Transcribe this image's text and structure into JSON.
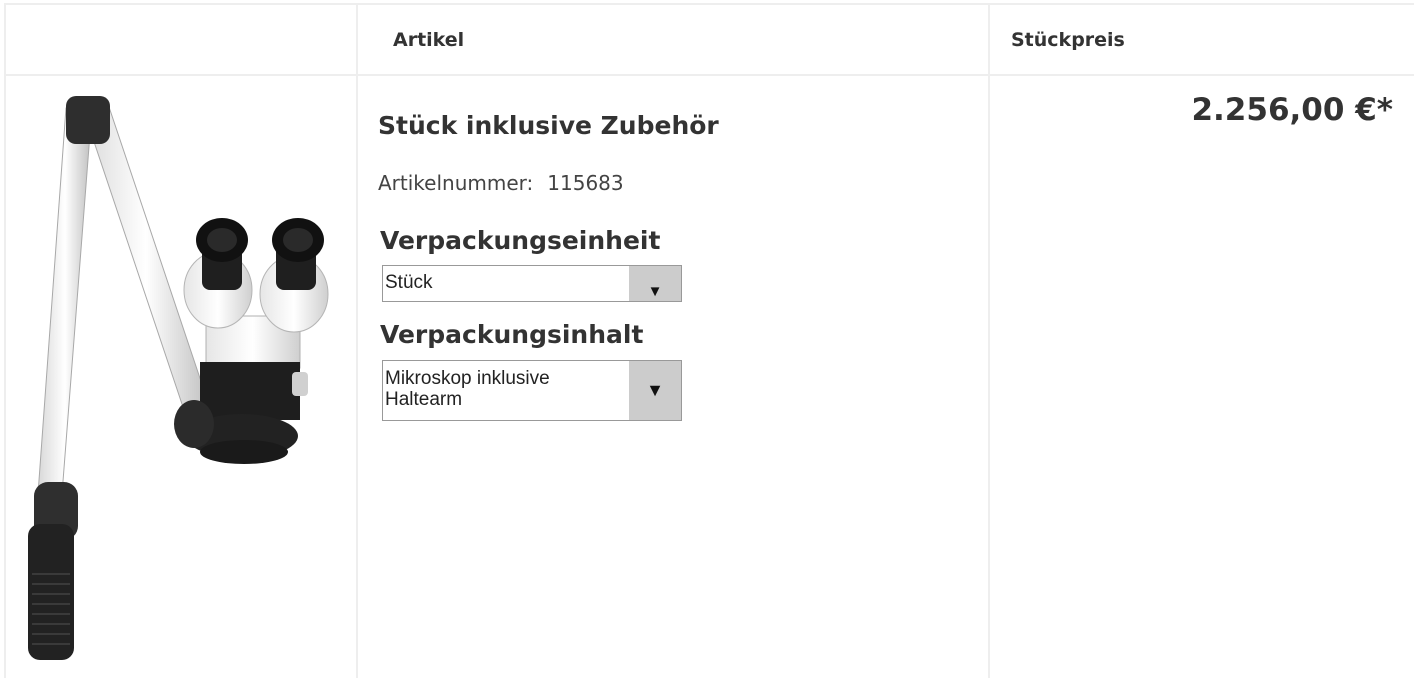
{
  "table": {
    "headers": {
      "article": "Artikel",
      "unit_price": "Stückpreis"
    }
  },
  "product": {
    "title": "Stück inklusive Zubehör",
    "article_number_label": "Artikelnummer:",
    "article_number": "115683",
    "image_icon": "microscope-image",
    "packaging_unit": {
      "label": "Verpackungseinheit",
      "selected": "Stück",
      "arrow": "▼"
    },
    "packaging_content": {
      "label": "Verpackungsinhalt",
      "selected_line1": "Mikroskop inklusive",
      "selected_line2": "Haltearm",
      "arrow": "▼"
    },
    "price": "2.256,00 €*"
  },
  "colors": {
    "border": "#eeeeee",
    "text": "#333333",
    "select_arrow_bg": "#cccccc"
  }
}
